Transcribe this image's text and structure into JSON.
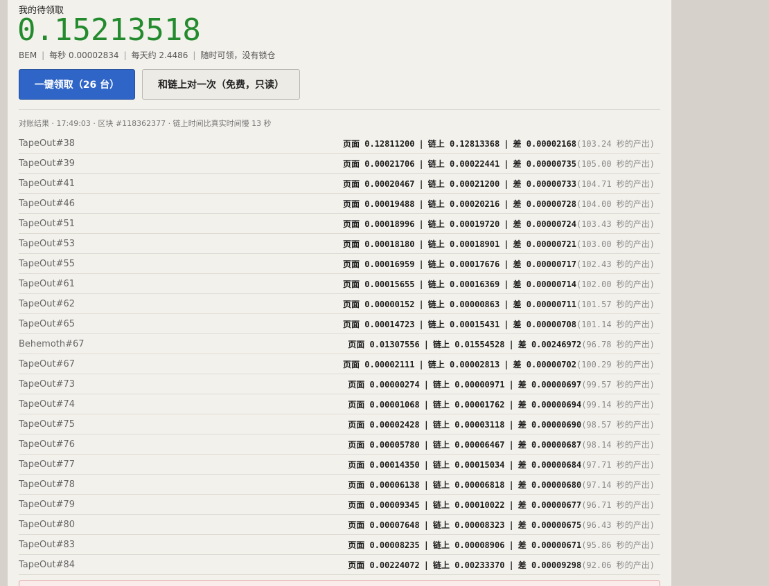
{
  "header": {
    "pending_label": "我的待领取",
    "pending_amount": "0.15213518",
    "token": "BEM",
    "per_second": "每秒 0.00002834",
    "per_day": "每天约 2.4486",
    "claim_note": "随时可领，没有锁仓"
  },
  "buttons": {
    "claim_all": "一键领取（26 台）",
    "reconcile": "和链上对一次（免费，只读）"
  },
  "reconcile": {
    "summary": "对账结果 · 17:49:03 · 区块 #118362377 · 链上时间比真实时间慢 13 秒"
  },
  "labels": {
    "page": "页面",
    "chain": "链上",
    "diff": "差",
    "sep": "|"
  },
  "rows": [
    {
      "name": "TapeOut#38",
      "page": "0.12811200",
      "chain": "0.12813368",
      "diff": "0.00002168",
      "note": "(103.24 秒的产出)"
    },
    {
      "name": "TapeOut#39",
      "page": "0.00021706",
      "chain": "0.00022441",
      "diff": "0.00000735",
      "note": "(105.00 秒的产出)"
    },
    {
      "name": "TapeOut#41",
      "page": "0.00020467",
      "chain": "0.00021200",
      "diff": "0.00000733",
      "note": "(104.71 秒的产出)"
    },
    {
      "name": "TapeOut#46",
      "page": "0.00019488",
      "chain": "0.00020216",
      "diff": "0.00000728",
      "note": "(104.00 秒的产出)"
    },
    {
      "name": "TapeOut#51",
      "page": "0.00018996",
      "chain": "0.00019720",
      "diff": "0.00000724",
      "note": "(103.43 秒的产出)"
    },
    {
      "name": "TapeOut#53",
      "page": "0.00018180",
      "chain": "0.00018901",
      "diff": "0.00000721",
      "note": "(103.00 秒的产出)"
    },
    {
      "name": "TapeOut#55",
      "page": "0.00016959",
      "chain": "0.00017676",
      "diff": "0.00000717",
      "note": "(102.43 秒的产出)"
    },
    {
      "name": "TapeOut#61",
      "page": "0.00015655",
      "chain": "0.00016369",
      "diff": "0.00000714",
      "note": "(102.00 秒的产出)"
    },
    {
      "name": "TapeOut#62",
      "page": "0.00000152",
      "chain": "0.00000863",
      "diff": "0.00000711",
      "note": "(101.57 秒的产出)"
    },
    {
      "name": "TapeOut#65",
      "page": "0.00014723",
      "chain": "0.00015431",
      "diff": "0.00000708",
      "note": "(101.14 秒的产出)"
    },
    {
      "name": "Behemoth#67",
      "page": "0.01307556",
      "chain": "0.01554528",
      "diff": "0.00246972",
      "note": "(96.78 秒的产出)"
    },
    {
      "name": "TapeOut#67",
      "page": "0.00002111",
      "chain": "0.00002813",
      "diff": "0.00000702",
      "note": "(100.29 秒的产出)"
    },
    {
      "name": "TapeOut#73",
      "page": "0.00000274",
      "chain": "0.00000971",
      "diff": "0.00000697",
      "note": "(99.57 秒的产出)"
    },
    {
      "name": "TapeOut#74",
      "page": "0.00001068",
      "chain": "0.00001762",
      "diff": "0.00000694",
      "note": "(99.14 秒的产出)"
    },
    {
      "name": "TapeOut#75",
      "page": "0.00002428",
      "chain": "0.00003118",
      "diff": "0.00000690",
      "note": "(98.57 秒的产出)"
    },
    {
      "name": "TapeOut#76",
      "page": "0.00005780",
      "chain": "0.00006467",
      "diff": "0.00000687",
      "note": "(98.14 秒的产出)"
    },
    {
      "name": "TapeOut#77",
      "page": "0.00014350",
      "chain": "0.00015034",
      "diff": "0.00000684",
      "note": "(97.71 秒的产出)"
    },
    {
      "name": "TapeOut#78",
      "page": "0.00006138",
      "chain": "0.00006818",
      "diff": "0.00000680",
      "note": "(97.14 秒的产出)"
    },
    {
      "name": "TapeOut#79",
      "page": "0.00009345",
      "chain": "0.00010022",
      "diff": "0.00000677",
      "note": "(96.71 秒的产出)"
    },
    {
      "name": "TapeOut#80",
      "page": "0.00007648",
      "chain": "0.00008323",
      "diff": "0.00000675",
      "note": "(96.43 秒的产出)"
    },
    {
      "name": "TapeOut#83",
      "page": "0.00008235",
      "chain": "0.00008906",
      "diff": "0.00000671",
      "note": "(95.86 秒的产出)"
    },
    {
      "name": "TapeOut#84",
      "page": "0.00224072",
      "chain": "0.00233370",
      "diff": "0.00009298",
      "note": "(92.06 秒的产出)"
    }
  ]
}
